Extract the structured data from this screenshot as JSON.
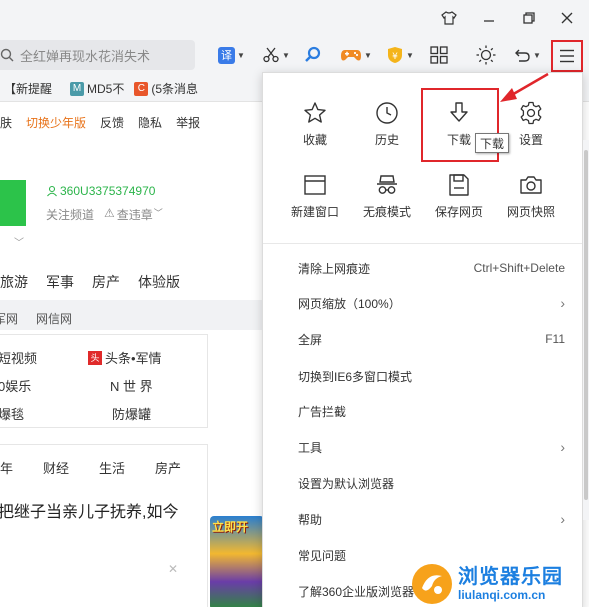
{
  "window": {
    "buttons": [
      "skin",
      "minimize",
      "restore",
      "close"
    ]
  },
  "toolbar": {
    "address_text": "全红婵再现水花消失术",
    "icons": [
      "translate-icon",
      "scissors-icon",
      "search-icon",
      "game-icon",
      "coin-icon",
      "apps-grid-icon",
      "brightness-icon",
      "undo-icon",
      "menu-icon"
    ],
    "translate_label": "译"
  },
  "bookmarks": [
    {
      "badge": "",
      "label": "【新提醒",
      "color": "#f3f4f6"
    },
    {
      "badge": "M",
      "label": "MD5不",
      "color": "#4a9aa8"
    },
    {
      "badge": "C",
      "label": "(5条消息",
      "color": "#e8562a"
    }
  ],
  "page": {
    "toplinks": [
      "肤",
      "切换少年版",
      "反馈",
      "隐私",
      "举报"
    ],
    "toplink_highlight": "切换少年版",
    "user_id": "360U3375374970",
    "user_follow": "关注频道",
    "user_warn": "查违章",
    "navcats": [
      "旅游",
      "军事",
      "房产",
      "体验版"
    ],
    "graytabs": [
      "军网",
      "网信网"
    ],
    "card1": {
      "col1": [
        "短视频",
        "0娱乐",
        "爆毯"
      ],
      "col2": [
        "头条•军情",
        "N 世 界",
        "防爆罐"
      ],
      "tou": "头"
    },
    "newstabs": [
      "年",
      "财经",
      "生活",
      "房产"
    ],
    "news_headline": "把继子当亲儿子抚养,如今",
    "ad_label": "立即开"
  },
  "menu": {
    "grid": [
      {
        "icon": "star-icon",
        "label": "收藏"
      },
      {
        "icon": "clock-icon",
        "label": "历史"
      },
      {
        "icon": "download-icon",
        "label": "下载"
      },
      {
        "icon": "gear-icon",
        "label": "设置"
      },
      {
        "icon": "new-window-icon",
        "label": "新建窗口"
      },
      {
        "icon": "incognito-icon",
        "label": "无痕模式"
      },
      {
        "icon": "save-icon",
        "label": "保存网页"
      },
      {
        "icon": "camera-icon",
        "label": "网页快照"
      }
    ],
    "tooltip": "下载",
    "items": [
      {
        "label": "清除上网痕迹",
        "right": "Ctrl+Shift+Delete",
        "arrow": false
      },
      {
        "label": "网页缩放（100%）",
        "right": "",
        "arrow": true
      },
      {
        "label": "全屏",
        "right": "F11",
        "arrow": false
      },
      {
        "label": "切换到IE6多窗口模式",
        "right": "",
        "arrow": false
      },
      {
        "label": "广告拦截",
        "right": "",
        "arrow": false
      },
      {
        "label": "工具",
        "right": "",
        "arrow": true
      },
      {
        "label": "设置为默认浏览器",
        "right": "",
        "arrow": false
      },
      {
        "label": "帮助",
        "right": "",
        "arrow": true
      },
      {
        "label": "常见问题",
        "right": "",
        "arrow": false
      },
      {
        "label": "了解360企业版浏览器",
        "right": "",
        "arrow": false
      }
    ]
  },
  "watermark": {
    "cn": "浏览器乐园",
    "en": "liulanqi.com.cn"
  },
  "colors": {
    "highlight_red": "#e0262b",
    "green": "#2cc34a",
    "toplink_orange": "#e8731a",
    "watermark_blue": "#1c7fe0"
  }
}
